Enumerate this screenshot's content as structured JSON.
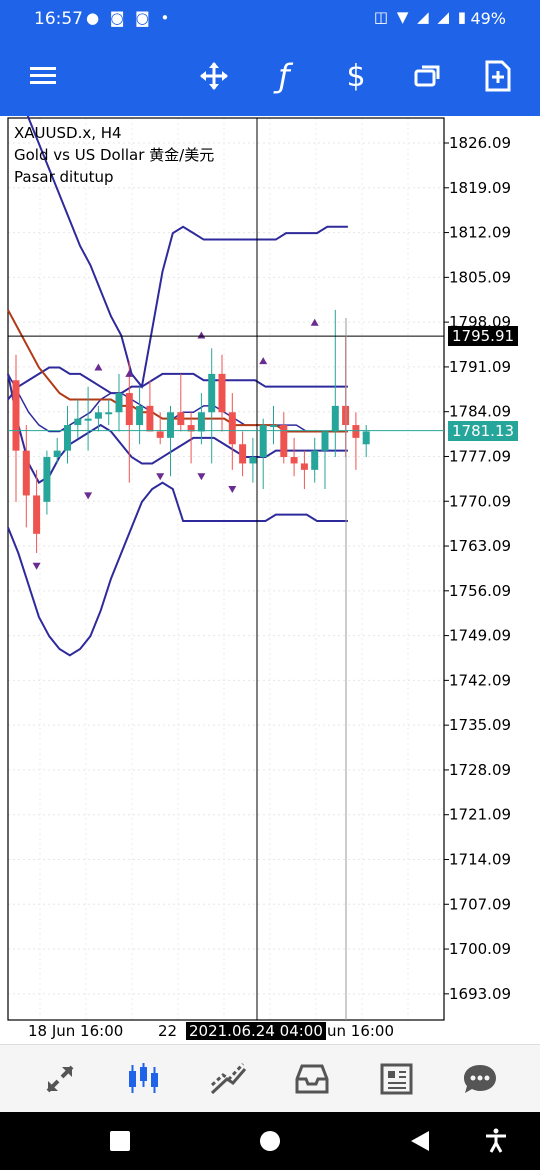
{
  "status_bar": {
    "time": "16:57",
    "notification_icons": "● ◙ ◙ •",
    "system_icons": "◫ ▼ ◢ ◢ ▮",
    "battery": "49%"
  },
  "toolbar": {
    "menu_icon": "≡",
    "crosshair_icon": "✥",
    "indicator_icon": "ƒ",
    "trade_icon": "$",
    "objects_icon": "❐",
    "add_icon": "+"
  },
  "chart": {
    "symbol_line": "XAUUSD.x, H4",
    "description_line": "Gold vs US Dollar 黄金/美元",
    "status_line": "Pasar ditutup",
    "cross_price": "1795.91",
    "last_price": "1781.13",
    "cross_date": "2021.06.24 04:00",
    "date_left": "18 Jun 16:00",
    "date_mid": "22",
    "date_right": "un 16:00",
    "colors": {
      "bull": "#26a69a",
      "bear": "#ef5350",
      "band": "#2e2a9c",
      "ma": "#b23a16",
      "last_price_bg": "#26a69a",
      "cross_bg": "#000000"
    }
  },
  "chart_data": {
    "type": "candlestick",
    "ylim": [
      1689,
      1830
    ],
    "y_ticks": [
      "1826.09",
      "1819.09",
      "1812.09",
      "1805.09",
      "1798.09",
      "1791.09",
      "1784.09",
      "1777.09",
      "1770.09",
      "1763.09",
      "1756.09",
      "1749.09",
      "1742.09",
      "1735.09",
      "1728.09",
      "1721.09",
      "1714.09",
      "1707.09",
      "1700.09",
      "1693.09"
    ],
    "y_tick_values": [
      1826.09,
      1819.09,
      1812.09,
      1805.09,
      1798.09,
      1791.09,
      1784.09,
      1777.09,
      1770.09,
      1763.09,
      1756.09,
      1749.09,
      1742.09,
      1735.09,
      1728.09,
      1721.09,
      1714.09,
      1707.09,
      1700.09,
      1693.09
    ],
    "candles": [
      {
        "o": 1789,
        "h": 1793,
        "l": 1770,
        "c": 1778
      },
      {
        "o": 1778,
        "h": 1782,
        "l": 1766,
        "c": 1771
      },
      {
        "o": 1771,
        "h": 1775,
        "l": 1762,
        "c": 1765
      },
      {
        "o": 1770,
        "h": 1778,
        "l": 1768,
        "c": 1777
      },
      {
        "o": 1777,
        "h": 1780,
        "l": 1776,
        "c": 1778
      },
      {
        "o": 1778,
        "h": 1785,
        "l": 1776,
        "c": 1782
      },
      {
        "o": 1782,
        "h": 1786,
        "l": 1780,
        "c": 1783
      },
      {
        "o": 1783,
        "h": 1788,
        "l": 1778,
        "c": 1783
      },
      {
        "o": 1783,
        "h": 1785,
        "l": 1781,
        "c": 1784
      },
      {
        "o": 1784,
        "h": 1786,
        "l": 1782,
        "c": 1784
      },
      {
        "o": 1784,
        "h": 1790,
        "l": 1781,
        "c": 1787
      },
      {
        "o": 1787,
        "h": 1792,
        "l": 1773,
        "c": 1782
      },
      {
        "o": 1782,
        "h": 1788,
        "l": 1779,
        "c": 1785
      },
      {
        "o": 1785,
        "h": 1789,
        "l": 1783,
        "c": 1781
      },
      {
        "o": 1781,
        "h": 1784,
        "l": 1779,
        "c": 1780
      },
      {
        "o": 1780,
        "h": 1785,
        "l": 1774,
        "c": 1784
      },
      {
        "o": 1784,
        "h": 1790,
        "l": 1781,
        "c": 1782
      },
      {
        "o": 1782,
        "h": 1784,
        "l": 1776,
        "c": 1781
      },
      {
        "o": 1781,
        "h": 1787,
        "l": 1779,
        "c": 1784
      },
      {
        "o": 1784,
        "h": 1794,
        "l": 1776,
        "c": 1790
      },
      {
        "o": 1790,
        "h": 1793,
        "l": 1781,
        "c": 1784
      },
      {
        "o": 1784,
        "h": 1787,
        "l": 1775,
        "c": 1779
      },
      {
        "o": 1779,
        "h": 1781,
        "l": 1774,
        "c": 1776
      },
      {
        "o": 1776,
        "h": 1780,
        "l": 1773,
        "c": 1777
      },
      {
        "o": 1777,
        "h": 1783,
        "l": 1772,
        "c": 1782
      },
      {
        "o": 1782,
        "h": 1785,
        "l": 1779,
        "c": 1782
      },
      {
        "o": 1782,
        "h": 1784,
        "l": 1776,
        "c": 1777
      },
      {
        "o": 1777,
        "h": 1780,
        "l": 1774,
        "c": 1776
      },
      {
        "o": 1776,
        "h": 1778,
        "l": 1772,
        "c": 1775
      },
      {
        "o": 1775,
        "h": 1780,
        "l": 1773,
        "c": 1778
      },
      {
        "o": 1778,
        "h": 1780,
        "l": 1772,
        "c": 1781
      },
      {
        "o": 1781,
        "h": 1800,
        "l": 1777,
        "c": 1785
      },
      {
        "o": 1785,
        "h": 1796,
        "l": 1777,
        "c": 1782
      },
      {
        "o": 1782,
        "h": 1784,
        "l": 1775,
        "c": 1780
      },
      {
        "o": 1779,
        "h": 1782,
        "l": 1777,
        "c": 1781
      }
    ],
    "upper_band": [
      1840,
      1835,
      1830,
      1826,
      1822,
      1818,
      1814,
      1810,
      1807,
      1803,
      1799,
      1796,
      1790,
      1788,
      1797,
      1806,
      1812,
      1813,
      1812,
      1811,
      1811,
      1811,
      1811,
      1811,
      1811,
      1811,
      1811,
      1812,
      1812,
      1812,
      1812,
      1813,
      1813,
      1813
    ],
    "middle_band": [
      1790,
      1787,
      1784,
      1782,
      1781,
      1781,
      1782,
      1783,
      1784,
      1786,
      1787,
      1787,
      1786,
      1785,
      1784,
      1783,
      1783,
      1784,
      1784,
      1785,
      1785,
      1784,
      1783,
      1782,
      1782,
      1782,
      1782,
      1782,
      1782,
      1781,
      1781,
      1781,
      1781,
      1781
    ],
    "lower_band": [
      1766,
      1762,
      1757,
      1752,
      1749,
      1747,
      1746,
      1747,
      1749,
      1753,
      1758,
      1762,
      1766,
      1770,
      1772,
      1773,
      1772,
      1767,
      1767,
      1767,
      1767,
      1767,
      1767,
      1767,
      1767,
      1767,
      1768,
      1768,
      1768,
      1768,
      1767,
      1767,
      1767,
      1767
    ],
    "inner_upper": [
      1786,
      1788,
      1789,
      1790,
      1791,
      1791,
      1790,
      1790,
      1789,
      1788,
      1787,
      1787,
      1788,
      1788,
      1789,
      1790,
      1790,
      1790,
      1790,
      1789,
      1789,
      1789,
      1789,
      1789,
      1789,
      1788,
      1788,
      1788,
      1788,
      1788,
      1788,
      1788,
      1788,
      1788
    ],
    "inner_lower": [
      1790,
      1782,
      1776,
      1773,
      1774,
      1777,
      1779,
      1780,
      1781,
      1782,
      1781,
      1779,
      1777,
      1776,
      1776,
      1777,
      1778,
      1779,
      1780,
      1780,
      1780,
      1779,
      1778,
      1777,
      1777,
      1777,
      1778,
      1778,
      1778,
      1778,
      1778,
      1778,
      1778,
      1778
    ],
    "ma_line": [
      1800,
      1797,
      1794,
      1791,
      1789,
      1787,
      1786,
      1786,
      1786,
      1786,
      1786,
      1785,
      1785,
      1784,
      1784,
      1783,
      1783,
      1783,
      1783,
      1783,
      1783,
      1783,
      1782,
      1782,
      1782,
      1782,
      1782,
      1781,
      1781,
      1781,
      1781,
      1781,
      1781,
      1781
    ],
    "fractal_up": [
      [
        8,
        1791
      ],
      [
        11,
        1790
      ],
      [
        18,
        1796
      ],
      [
        24,
        1792
      ],
      [
        29,
        1798
      ]
    ],
    "fractal_down": [
      [
        2,
        1760
      ],
      [
        7,
        1771
      ],
      [
        14,
        1774
      ],
      [
        18,
        1774
      ],
      [
        21,
        1772
      ]
    ]
  },
  "bottom_nav": {
    "quotes_icon": "⇅",
    "chart_icon": "⧗",
    "trade_icon": "↗",
    "history_icon": "▭",
    "news_icon": "▤",
    "messages_icon": "…"
  },
  "system_nav": {
    "recents": "■",
    "home": "●",
    "back": "◀",
    "a11y": "♿"
  }
}
